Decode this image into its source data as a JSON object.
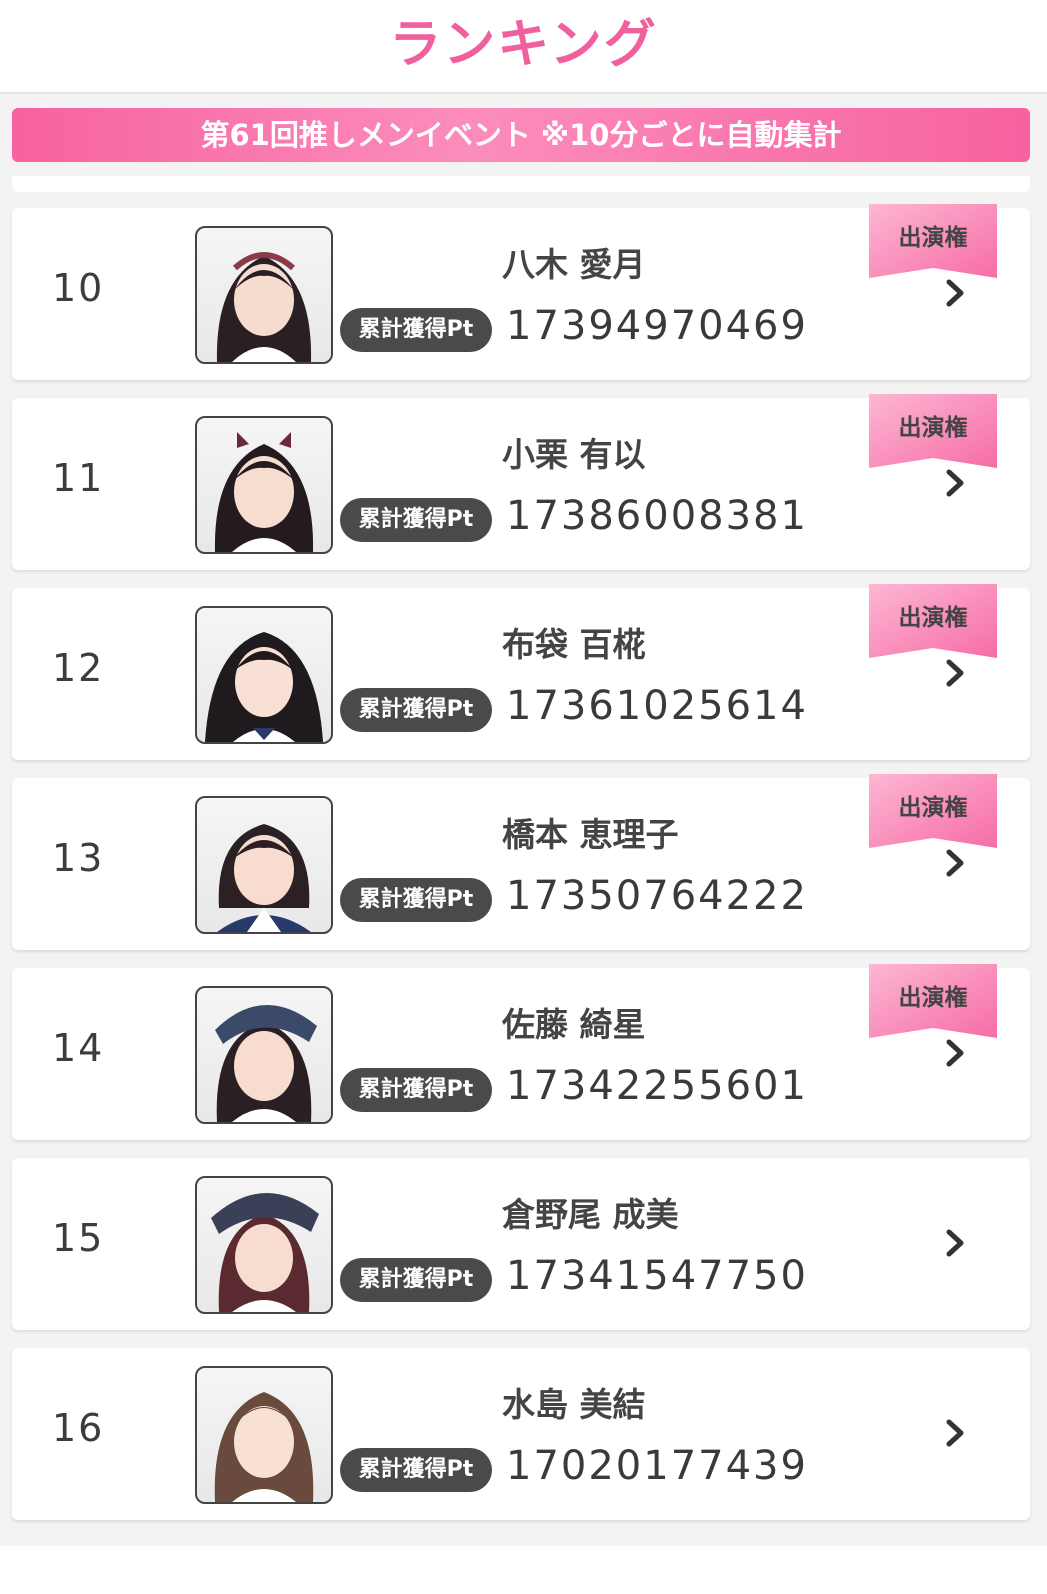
{
  "header": {
    "title": "ランキング"
  },
  "event": {
    "banner": "第61回推しメンイベント ※10分ごとに自動集計"
  },
  "colors": {
    "accent": "#f0609e",
    "badge": "#4a4a4a",
    "ribbon": "#f987b8"
  },
  "ranking": [
    {
      "rank": "10",
      "name": "八木 愛月",
      "pt_label": "累計獲得Pt",
      "points": "17394970469",
      "ribbon": "出演権"
    },
    {
      "rank": "11",
      "name": "小栗 有以",
      "pt_label": "累計獲得Pt",
      "points": "17386008381",
      "ribbon": "出演権"
    },
    {
      "rank": "12",
      "name": "布袋 百椛",
      "pt_label": "累計獲得Pt",
      "points": "17361025614",
      "ribbon": "出演権"
    },
    {
      "rank": "13",
      "name": "橋本 恵理子",
      "pt_label": "累計獲得Pt",
      "points": "17350764222",
      "ribbon": "出演権"
    },
    {
      "rank": "14",
      "name": "佐藤 綺星",
      "pt_label": "累計獲得Pt",
      "points": "17342255601",
      "ribbon": "出演権"
    },
    {
      "rank": "15",
      "name": "倉野尾 成美",
      "pt_label": "累計獲得Pt",
      "points": "17341547750"
    },
    {
      "rank": "16",
      "name": "水島 美結",
      "pt_label": "累計獲得Pt",
      "points": "17020177439"
    }
  ]
}
